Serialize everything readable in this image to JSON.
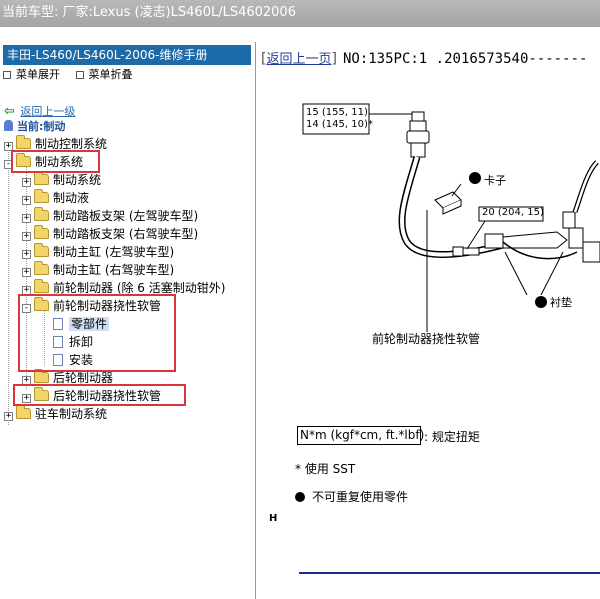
{
  "window": {
    "title": "当前车型:  厂家:Lexus (凌志)LS460L/LS4602006"
  },
  "left_panel": {
    "header": "丰田-LS460/LS460L-2006-维修手册",
    "expand_label": "菜单展开",
    "collapse_label": "菜单折叠",
    "back_link": "返回上一级",
    "current_label": "当前:制动",
    "tree": [
      {
        "label": "制动控制系统",
        "toggle": "+",
        "icon": "folder"
      },
      {
        "label": "制动系统",
        "toggle": "-",
        "icon": "folder"
      },
      {
        "label": "制动系统",
        "toggle": "+",
        "icon": "folder"
      },
      {
        "label": "制动液",
        "toggle": "+",
        "icon": "folder"
      },
      {
        "label": "制动踏板支架 (左驾驶车型)",
        "toggle": "+",
        "icon": "folder"
      },
      {
        "label": "制动踏板支架 (右驾驶车型)",
        "toggle": "+",
        "icon": "folder"
      },
      {
        "label": "制动主缸 (左驾驶车型)",
        "toggle": "+",
        "icon": "folder"
      },
      {
        "label": "制动主缸 (右驾驶车型)",
        "toggle": "+",
        "icon": "folder"
      },
      {
        "label": "前轮制动器 (除 6 活塞制动钳外)",
        "toggle": "+",
        "icon": "folder"
      },
      {
        "label": "前轮制动器挠性软管",
        "toggle": "-",
        "icon": "folder"
      },
      {
        "label": "零部件",
        "toggle": "",
        "icon": "doc",
        "selected": true
      },
      {
        "label": "拆卸",
        "toggle": "",
        "icon": "doc"
      },
      {
        "label": "安装",
        "toggle": "",
        "icon": "doc"
      },
      {
        "label": "后轮制动器",
        "toggle": "+",
        "icon": "folder"
      },
      {
        "label": "后轮制动器挠性软管",
        "toggle": "+",
        "icon": "folder"
      },
      {
        "label": "驻车制动系统",
        "toggle": "+",
        "icon": "folder"
      }
    ]
  },
  "right_panel": {
    "back_link": "返回上一页",
    "doc_number": "NO:135PC:1 .2016573540-------",
    "diagram": {
      "torque_1a": "15 (155, 11)",
      "torque_1b": "14 (145, 10)*",
      "clip_label": "卡子",
      "torque_2": "20 (204, 15)",
      "gasket_label": "衬垫",
      "hose_label": "前轮制动器挠性软管"
    },
    "legend": {
      "torque_unit": "N*m (kgf*cm, ft.*lbf)",
      "torque_desc": ": 规定扭矩",
      "sst_note": "* 使用 SST",
      "nonreusable_note": "不可重复使用零件",
      "marker": "H"
    }
  },
  "colors": {
    "title_bar": "#a9a9a9",
    "panel_header": "#1d6aa8",
    "highlight_box": "#d8363a",
    "folder": "#f2d56a",
    "link": "#1f3c9a"
  }
}
